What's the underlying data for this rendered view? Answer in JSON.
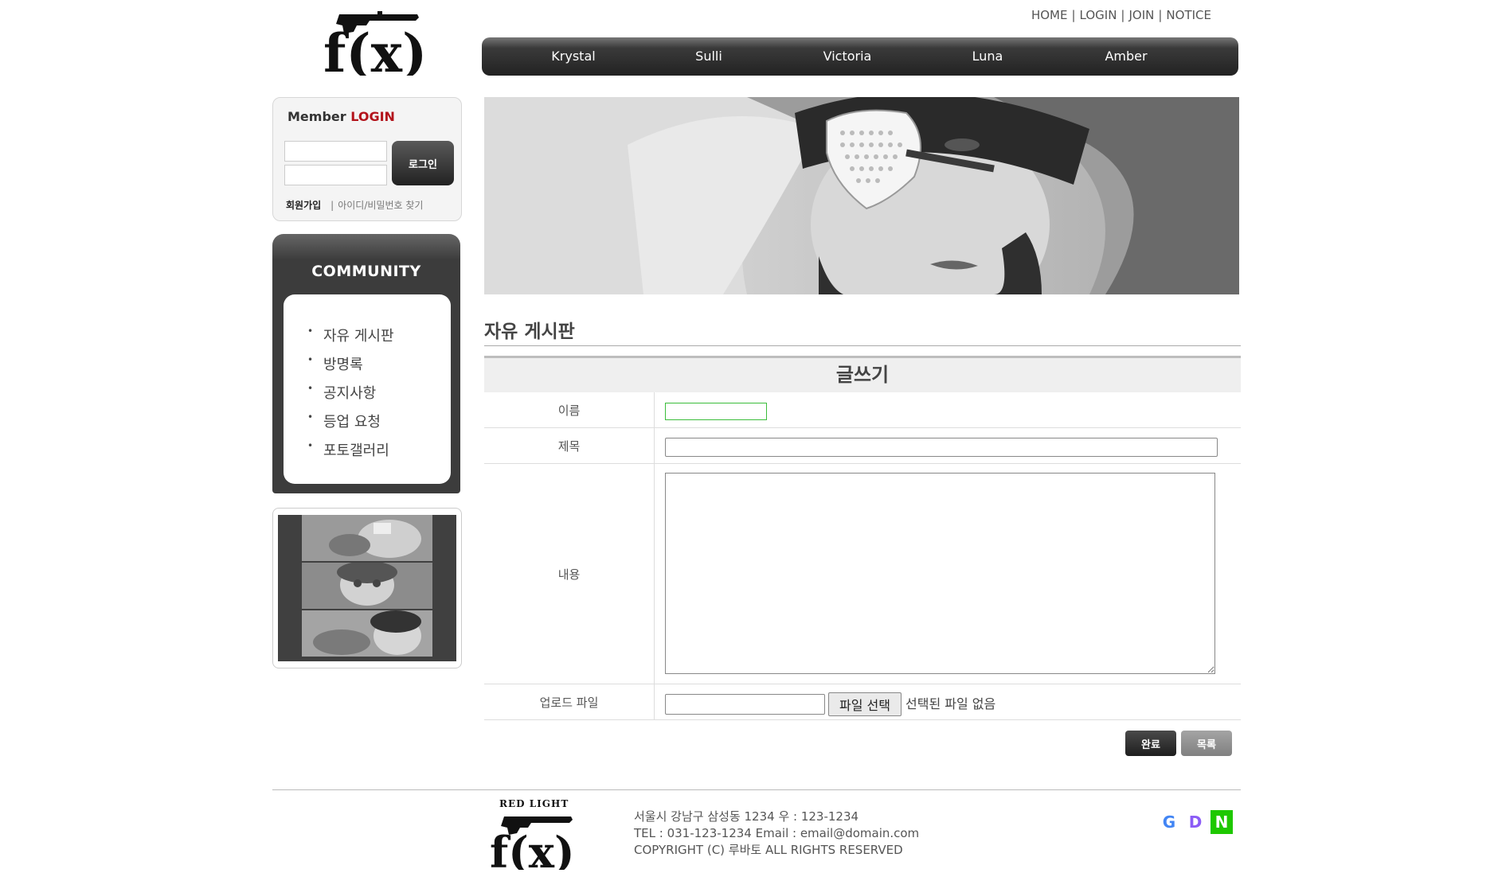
{
  "header": {
    "logo_text": "f(x)",
    "util_nav": [
      "HOME",
      "LOGIN",
      "JOIN",
      "NOTICE"
    ],
    "gnb": [
      "Krystal",
      "Sulli",
      "Victoria",
      "Luna",
      "Amber"
    ]
  },
  "login": {
    "title_prefix": "Member",
    "title_accent": "LOGIN",
    "button_label": "로그인",
    "join_link": "회원가입",
    "find_link": "아이디/비밀번호 찾기"
  },
  "community": {
    "title": "COMMUNITY",
    "items": [
      "자유 게시판",
      "방명록",
      "공지사항",
      "등업 요청",
      "포토갤러리"
    ]
  },
  "board": {
    "title": "자유 게시판",
    "form_header": "글쓰기",
    "fields": {
      "name_label": "이름",
      "subject_label": "제목",
      "content_label": "내용",
      "file_label": "업로드 파일"
    },
    "file_select_label": "파일 선택",
    "file_none_text": "선택된 파일 없음",
    "name_value": "",
    "subject_value": "",
    "content_value": "",
    "done_button": "완료",
    "list_button": "목록"
  },
  "footer": {
    "logo_top_text": "RED LIGHT",
    "logo_text": "f(x)",
    "address": "서울시 강남구 삼성동 1234 우 : 123-1234",
    "contact": "TEL : 031-123-1234 Email : email@domain.com",
    "copyright": "COPYRIGHT (C) 루바토 ALL RIGHTS RESERVED",
    "sns": [
      {
        "letter": "G",
        "color": "#4285f4"
      },
      {
        "letter": "D",
        "color": "#8b5cf6"
      },
      {
        "letter": "N",
        "color": "#ffffff",
        "bg": "#1ec800"
      }
    ]
  },
  "colors": {
    "accent_red": "#b3141c",
    "nav_dark": "#2a2a2a",
    "focus_green": "#3bbd3b"
  }
}
